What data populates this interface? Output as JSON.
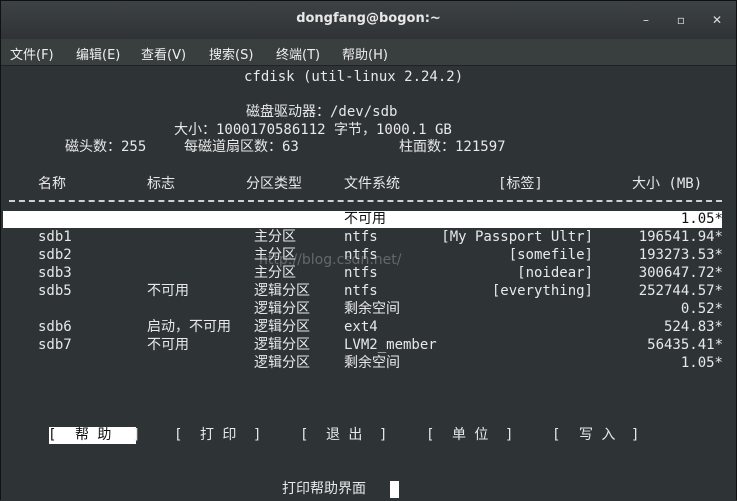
{
  "window": {
    "title": "dongfang@bogon:~",
    "minimize": "–",
    "maximize": "▫",
    "close": "✕"
  },
  "menu": [
    "文件(F)",
    "编辑(E)",
    "查看(V)",
    "搜索(S)",
    "终端(T)",
    "帮助(H)"
  ],
  "header": {
    "app": "cfdisk (util-linux 2.24.2)",
    "drive_label": "磁盘驱动器：/dev/sdb",
    "size_label": "大小：1000170586112 字节，1000.1 GB",
    "heads_label": "磁头数：255",
    "sectors_label": "每磁道扇区数：63",
    "cylinders_label": "柱面数：121597"
  },
  "columns": {
    "name": "名称",
    "flags": "标志",
    "part_type": "分区类型",
    "fs_type": "文件系统",
    "label": "[标签]",
    "size": "大小 (MB)"
  },
  "rows": [
    {
      "name": "",
      "flags": "",
      "part_type": "",
      "fs_type": "不可用",
      "label": "",
      "size": "1.05*",
      "selected": true
    },
    {
      "name": "sdb1",
      "flags": "",
      "part_type": "主分区",
      "fs_type": "ntfs",
      "label": "[My Passport Ultr]",
      "size": "196541.94*"
    },
    {
      "name": "sdb2",
      "flags": "",
      "part_type": "主分区",
      "fs_type": "ntfs",
      "label": "[somefile]",
      "size": "193273.53*"
    },
    {
      "name": "sdb3",
      "flags": "",
      "part_type": "主分区",
      "fs_type": "ntfs",
      "label": "[noidear]",
      "size": "300647.72*"
    },
    {
      "name": "sdb5",
      "flags": "不可用",
      "part_type": "逻辑分区",
      "fs_type": "ntfs",
      "label": "[everything]",
      "size": "252744.57*"
    },
    {
      "name": "",
      "flags": "",
      "part_type": "逻辑分区",
      "fs_type": "剩余空间",
      "label": "",
      "size": "0.52*"
    },
    {
      "name": "sdb6",
      "flags": "启动，不可用",
      "part_type": "逻辑分区",
      "fs_type": "ext4",
      "label": "",
      "size": "524.83*"
    },
    {
      "name": "sdb7",
      "flags": "不可用",
      "part_type": "逻辑分区",
      "fs_type": "LVM2_member",
      "label": "",
      "size": "56435.41*"
    },
    {
      "name": "",
      "flags": "",
      "part_type": "逻辑分区",
      "fs_type": "剩余空间",
      "label": "",
      "size": "1.05*"
    }
  ],
  "watermark": "http://blog.csdn.net/",
  "buttons": {
    "help": "帮 助",
    "print": "打 印",
    "quit": "退 出",
    "units": "单 位",
    "write": "写 入"
  },
  "status": "打印帮助界面"
}
